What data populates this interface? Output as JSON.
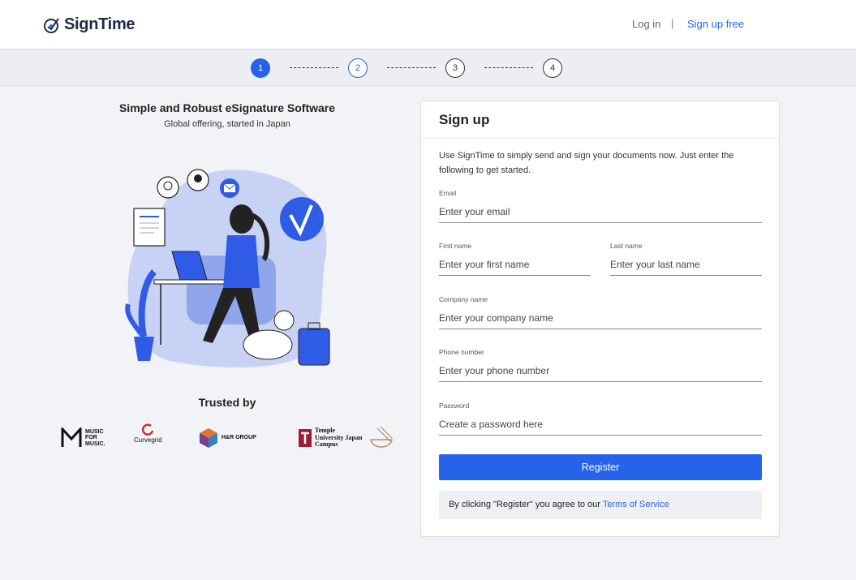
{
  "header": {
    "brand": "SignTime",
    "login_label": "Log in",
    "separator": "|",
    "signup_label": "Sign up free"
  },
  "stepper": {
    "steps": [
      "1",
      "2",
      "3",
      "4"
    ],
    "active_step": 1
  },
  "hero": {
    "title": "Simple and Robust eSignature Software",
    "subtitle": "Global offering, started in Japan"
  },
  "trusted": {
    "title": "Trusted by",
    "logos": [
      {
        "name": "music-for-music",
        "text": "MUSIC FOR MUSIC."
      },
      {
        "name": "curvegrid",
        "text": "Curvegrid"
      },
      {
        "name": "hr-group",
        "text": "H&R GROUP"
      },
      {
        "name": "temple-university",
        "text": "Temple University Japan Campus"
      },
      {
        "name": "ramen",
        "text": ""
      }
    ]
  },
  "form": {
    "title": "Sign up",
    "intro": "Use SignTime to simply send and sign your documents now. Just enter the following to get started.",
    "email": {
      "label": "Email",
      "placeholder": "Enter your email",
      "value": ""
    },
    "first_name": {
      "label": "First name",
      "placeholder": "Enter your first name",
      "value": ""
    },
    "last_name": {
      "label": "Last name",
      "placeholder": "Enter your last name",
      "value": ""
    },
    "company": {
      "label": "Company name",
      "placeholder": "Enter your company name",
      "value": ""
    },
    "phone": {
      "label": "Phone number",
      "placeholder": "Enter your phone number",
      "value": ""
    },
    "password": {
      "label": "Password",
      "placeholder": "Create a password here",
      "value": ""
    },
    "register_label": "Register",
    "terms_prefix": "By clicking \"Register\" you agree to our ",
    "terms_link": "Terms of Service"
  },
  "colors": {
    "accent": "#2563eb",
    "background": "#f2f3f6",
    "illustration_blue": "#c7d2f5"
  }
}
